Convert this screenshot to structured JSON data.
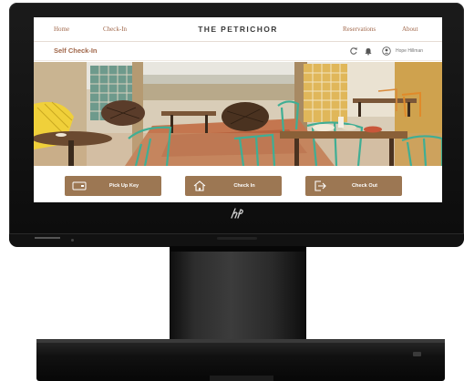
{
  "nav": {
    "links_left": [
      "Home",
      "Check-In"
    ],
    "brand": "THE PETRICHOR",
    "links_right": [
      "Reservations",
      "About"
    ]
  },
  "subbar": {
    "title": "Self Check-In",
    "icons": [
      "refresh-icon",
      "bell-icon",
      "user-icon"
    ],
    "user_name": "Hope Hillman"
  },
  "hero": {
    "alt": "restaurant-patio-photo"
  },
  "actions": [
    {
      "label": "Pick Up Key",
      "icon": "key-card-icon"
    },
    {
      "label": "Check In",
      "icon": "home-icon"
    },
    {
      "label": "Check Out",
      "icon": "exit-icon"
    }
  ],
  "colors": {
    "accent": "#9c7753",
    "accent_text": "#a0674a",
    "device": "#111111"
  },
  "device": {
    "logo": "hp"
  }
}
